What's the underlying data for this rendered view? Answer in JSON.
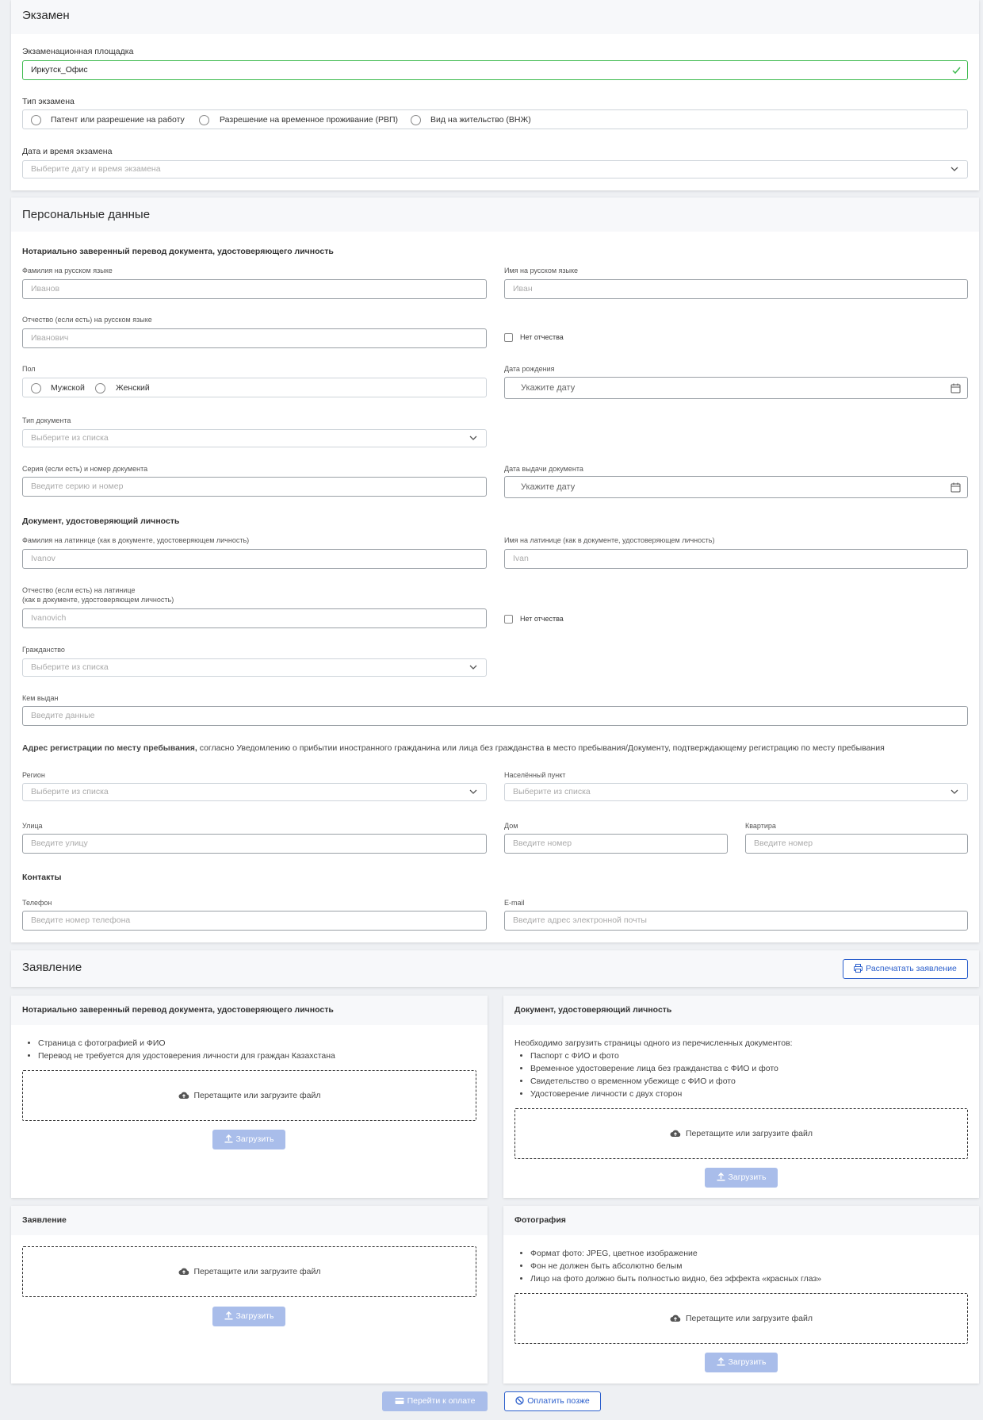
{
  "exam": {
    "title": "Экзамен",
    "venue_label": "Экзаменационная площадка",
    "venue_value": "Иркутск_Офис",
    "type_label": "Тип экзамена",
    "type_options": [
      "Патент или разрешение на работу",
      "Разрешение на временное проживание (РВП)",
      "Вид на жительство (ВНЖ)"
    ],
    "datetime_label": "Дата и время экзамена",
    "datetime_placeholder": "Выберите дату и время экзамена"
  },
  "personal": {
    "title": "Персональные данные",
    "notarized_heading": "Нотариально заверенный перевод документа, удостоверяющего личность",
    "surname_ru_label": "Фамилия на русском языке",
    "surname_ru_placeholder": "Иванов",
    "name_ru_label": "Имя на русском языке",
    "name_ru_placeholder": "Иван",
    "patronymic_ru_label": "Отчество (если есть) на русском языке",
    "patronymic_ru_placeholder": "Иванович",
    "no_patronymic": "Нет отчества",
    "gender_label": "Пол",
    "gender_options": [
      "Мужской",
      "Женский"
    ],
    "birthdate_label": "Дата рождения",
    "date_placeholder": "Укажите дату",
    "doc_type_label": "Тип документа",
    "select_placeholder": "Выберите из списка",
    "doc_number_label": "Серия (если есть) и номер документа",
    "doc_number_placeholder": "Введите серию и номер",
    "doc_issue_date_label": "Дата выдачи документа",
    "id_doc_heading": "Документ, удостоверяющий личность",
    "surname_lat_label": "Фамилия на латинице (как в документе, удостоверяющем личность)",
    "surname_lat_placeholder": "Ivanov",
    "name_lat_label": "Имя на латинице (как в документе, удостоверяющем личность)",
    "name_lat_placeholder": "Ivan",
    "patronymic_lat_label_1": "Отчество (если есть) на латинице",
    "patronymic_lat_label_2": "(как в документе, удостоверяющем личность)",
    "patronymic_lat_placeholder": "Ivanovich",
    "citizenship_label": "Гражданство",
    "issued_by_label": "Кем выдан",
    "issued_by_placeholder": "Введите данные",
    "address_heading": "Адрес регистрации по месту пребывания,",
    "address_note": " согласно Уведомлению о прибытии иностранного гражданина или лица без гражданства в место пребывания/Документу, подтверждающему регистрацию по месту пребывания",
    "region_label": "Регион",
    "locality_label": "Населённый пункт",
    "street_label": "Улица",
    "street_placeholder": "Введите улицу",
    "house_label": "Дом",
    "number_placeholder": "Введите номер",
    "apartment_label": "Квартира",
    "contacts_heading": "Контакты",
    "phone_label": "Телефон",
    "phone_placeholder": "Введите номер телефона",
    "email_label": "E-mail",
    "email_placeholder": "Введите адрес электронной почты"
  },
  "application": {
    "title": "Заявление",
    "print_button": "Распечатать заявление"
  },
  "uploads": {
    "drop_text": "Перетащите или загрузите файл",
    "upload_button": "Загрузить",
    "notarized": {
      "title": "Нотариально заверенный перевод документа, удостоверяющего личность",
      "bullets": [
        "Страница с фотографией и ФИО",
        "Перевод не требуется для удостоверения личности для граждан Казахстана"
      ]
    },
    "id_document": {
      "title": "Документ, удостоверяющий личность",
      "intro": "Необходимо загрузить страницы одного из перечисленных документов:",
      "bullets": [
        "Паспорт с ФИО и фото",
        "Временное удостоверение лица без гражданства с ФИО и фото",
        "Свидетельство о временном убежище с ФИО и фото",
        "Удостоверение личности с двух сторон"
      ]
    },
    "statement": {
      "title": "Заявление"
    },
    "photo": {
      "title": "Фотография",
      "bullets": [
        "Формат фото: JPEG, цветное изображение",
        "Фон не должен быть абсолютно белым",
        "Лицо на фото должно быть полностью видно, без эффекта «красных глаз»"
      ]
    }
  },
  "footer": {
    "pay_button": "Перейти к оплате",
    "pay_later_button": "Оплатить позже"
  },
  "colors": {
    "primary": "#2b5fcc",
    "disabled_button": "#a9bdea",
    "valid_border": "#3dba4e"
  }
}
